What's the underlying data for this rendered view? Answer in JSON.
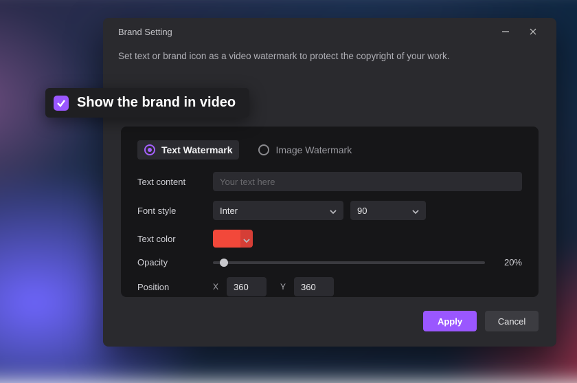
{
  "window": {
    "title": "Brand Setting",
    "description": "Set  text or brand icon as a video watermark to protect the copyright of your work."
  },
  "callout": {
    "label": "Show the brand in video",
    "checked": true
  },
  "tabs": {
    "text": "Text Watermark",
    "image": "Image Watermark",
    "selected": "text"
  },
  "fields": {
    "text_content": {
      "label": "Text content",
      "placeholder": "Your text here",
      "value": ""
    },
    "font_style": {
      "label": "Font style",
      "font": "Inter",
      "size": "90"
    },
    "text_color": {
      "label": "Text color",
      "value": "#f2483a"
    },
    "opacity": {
      "label": "Opacity",
      "value": 20,
      "display": "20%"
    },
    "position": {
      "label": "Position",
      "x_label": "X",
      "x": "360",
      "y_label": "Y",
      "y": "360"
    }
  },
  "buttons": {
    "apply": "Apply",
    "cancel": "Cancel"
  }
}
